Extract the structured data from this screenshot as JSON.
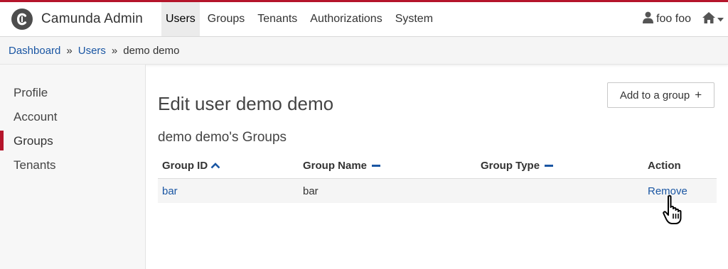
{
  "brand": {
    "name": "Camunda Admin",
    "logo_icon": "camunda-logo-icon"
  },
  "nav": {
    "items": [
      {
        "label": "Users",
        "active": true
      },
      {
        "label": "Groups",
        "active": false
      },
      {
        "label": "Tenants",
        "active": false
      },
      {
        "label": "Authorizations",
        "active": false
      },
      {
        "label": "System",
        "active": false
      }
    ]
  },
  "user_menu": {
    "name": "foo foo",
    "icon": "user-icon"
  },
  "home_menu": {
    "icon": "home-icon",
    "caret": "caret-down-icon"
  },
  "breadcrumb": {
    "items": [
      "Dashboard",
      "Users",
      "demo demo"
    ],
    "separator": "»"
  },
  "sidebar": {
    "items": [
      {
        "label": "Profile",
        "active": false
      },
      {
        "label": "Account",
        "active": false
      },
      {
        "label": "Groups",
        "active": true
      },
      {
        "label": "Tenants",
        "active": false
      }
    ]
  },
  "page": {
    "title": "Edit user demo demo",
    "section_title": "demo demo's Groups",
    "add_button": {
      "label": "Add to a group",
      "icon": "+"
    }
  },
  "table": {
    "columns": [
      {
        "label": "Group ID",
        "sort": "ascending"
      },
      {
        "label": "Group Name",
        "sort": "none"
      },
      {
        "label": "Group Type",
        "sort": "none"
      },
      {
        "label": "Action",
        "sort": null
      }
    ],
    "rows": [
      {
        "group_id": "bar",
        "group_name": "bar",
        "group_type": "",
        "action": "Remove"
      }
    ]
  },
  "colors": {
    "accent": "#b5152b",
    "link": "#1a56a3",
    "brand_logo": "#4d4d4d"
  }
}
